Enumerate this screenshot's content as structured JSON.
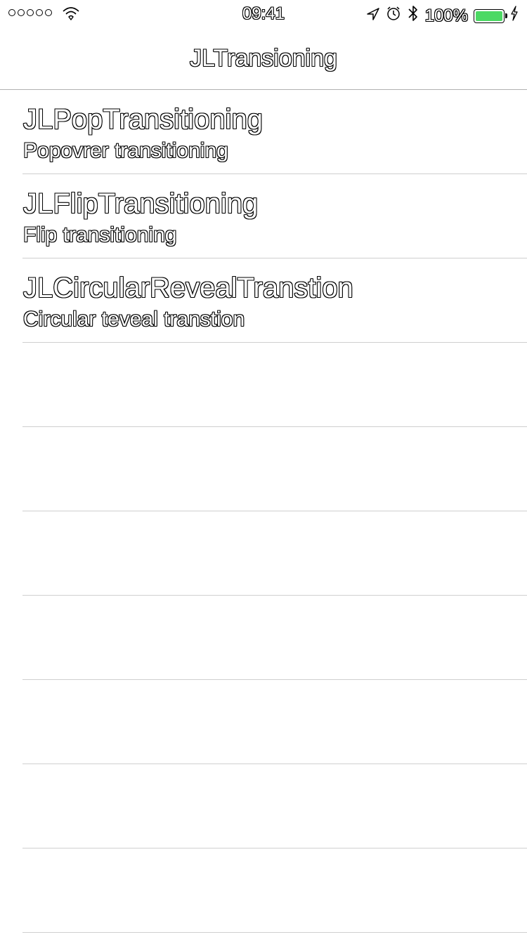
{
  "status_bar": {
    "time": "09:41",
    "battery_text": "100%",
    "signal_dots": 5,
    "battery_level": 1.0,
    "battery_color": "#4cd964"
  },
  "nav": {
    "title": "JLTransioning"
  },
  "rows": [
    {
      "title": "JLPopTransitioning",
      "subtitle": "Popovrer transitioning"
    },
    {
      "title": "JLFlipTransitioning",
      "subtitle": "Flip transitioning"
    },
    {
      "title": "JLCircularRevealTranstion",
      "subtitle": "Circular teveal transtion"
    }
  ],
  "empty_row_count": 7,
  "icons": {
    "wifi": "wifi-icon",
    "location": "location-arrow-icon",
    "alarm": "alarm-clock-icon",
    "bluetooth": "bluetooth-icon",
    "battery": "battery-icon",
    "charging": "charging-bolt-icon"
  }
}
